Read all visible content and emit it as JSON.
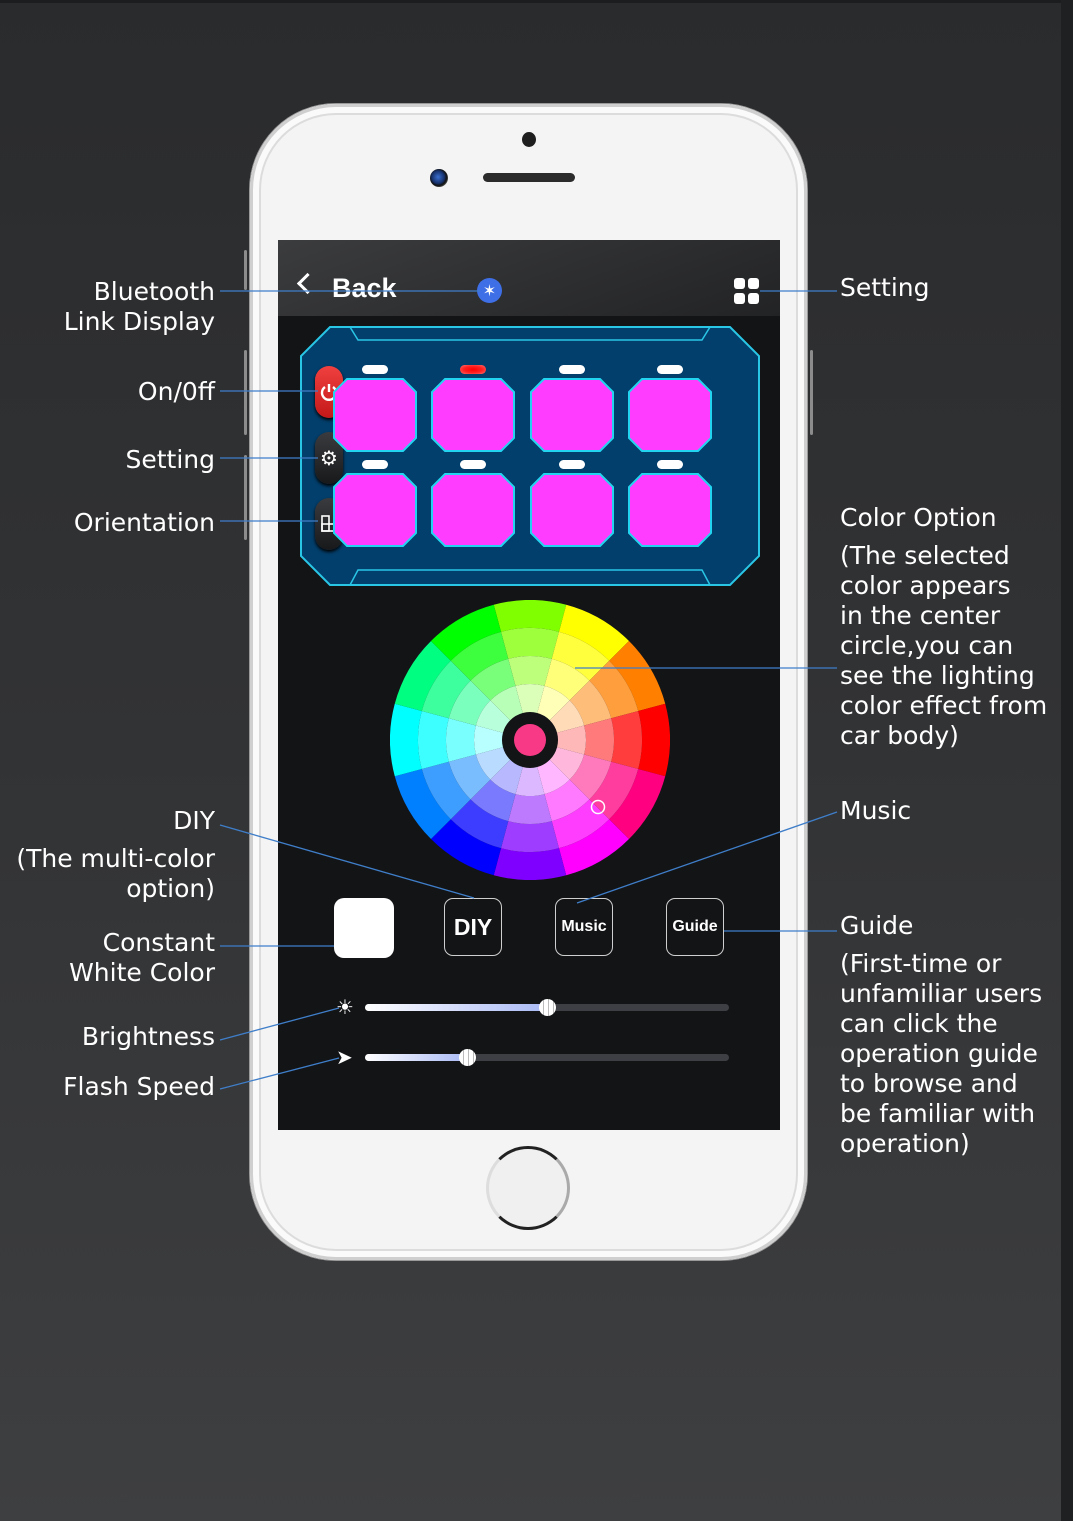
{
  "app": {
    "nav": {
      "back_label": "Back",
      "bluetooth_icon": "bluetooth-icon",
      "settings_icon": "grid-icon"
    },
    "side_controls": [
      {
        "name": "power",
        "icon": "power-icon",
        "color": "#e32a2a"
      },
      {
        "name": "setting",
        "icon": "gear-icon",
        "color": "#2a2b2e"
      },
      {
        "name": "orientation",
        "icon": "orientation-icon",
        "color": "#2a2b2e"
      }
    ],
    "pods": {
      "count": 8,
      "color": "#ff3cff",
      "border": "#22d4ef",
      "active_led_index": 1,
      "active_led_color": "#ff2020"
    },
    "color_wheel": {
      "selected_color": "#f83a86"
    },
    "mode_buttons": [
      {
        "id": "white",
        "label": ""
      },
      {
        "id": "diy",
        "label": "DIY"
      },
      {
        "id": "music",
        "label": "Music"
      },
      {
        "id": "guide",
        "label": "Guide"
      }
    ],
    "sliders": {
      "brightness": {
        "icon": "sun-icon",
        "value": 0.5
      },
      "flash_speed": {
        "icon": "arrow-icon",
        "value": 0.28
      }
    }
  },
  "annotations": {
    "bluetooth": "Bluetooth\nLink Display",
    "on_off": "On/0ff",
    "setting_left": "Setting",
    "orientation": "Orientation",
    "diy_title": "DIY",
    "diy_sub": "(The multi-color\noption)",
    "constant_white": "Constant\nWhite Color",
    "brightness": "Brightness",
    "flash_speed": "Flash Speed",
    "setting_right": "Setting",
    "color_option_title": "Color Option",
    "color_option_sub": "(The selected\ncolor appears\nin the center\ncircle,you can\nsee the lighting\ncolor effect from\ncar body)",
    "music": "Music",
    "guide_title": "Guide",
    "guide_sub": "(First-time or\nunfamiliar users\ncan click the\noperation guide\nto browse and\nbe familiar with\noperation)"
  },
  "colors": {
    "callout_line": "#3f7ec9",
    "background": "#2e2f31"
  }
}
